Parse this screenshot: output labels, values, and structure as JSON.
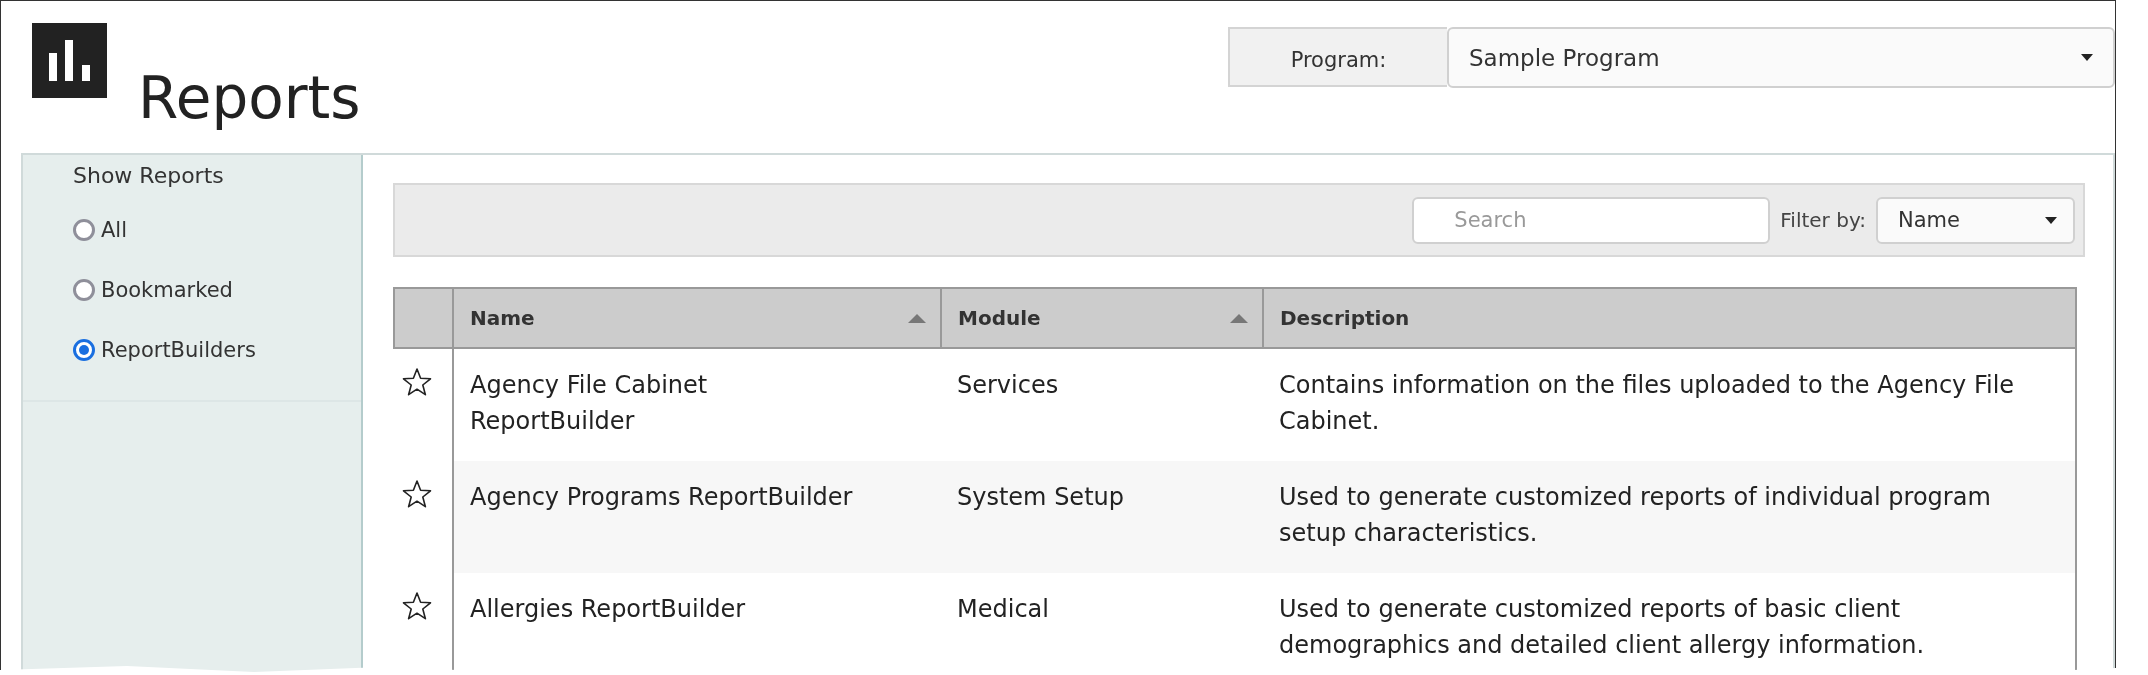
{
  "header": {
    "title": "Reports",
    "program_label": "Program:",
    "program_value": "Sample Program"
  },
  "sidebar": {
    "title": "Show Reports",
    "options": [
      {
        "label": "All",
        "selected": false
      },
      {
        "label": "Bookmarked",
        "selected": false
      },
      {
        "label": "ReportBuilders",
        "selected": true
      }
    ]
  },
  "toolbar": {
    "search": {
      "placeholder": "Search"
    },
    "filter_label": "Filter by:",
    "filter_value": "Name"
  },
  "table": {
    "columns": [
      {
        "label": "Name",
        "sorted": true
      },
      {
        "label": "Module",
        "sorted": true
      },
      {
        "label": "Description",
        "sorted": false
      }
    ],
    "rows": [
      {
        "bookmarked": false,
        "name": "Agency File Cabinet ReportBuilder",
        "module": "Services",
        "description": "Contains information on the files uploaded to the Agency File Cabinet."
      },
      {
        "bookmarked": false,
        "name": "Agency Programs ReportBuilder",
        "module": "System Setup",
        "description": "Used to generate customized reports of individual program setup characteristics."
      },
      {
        "bookmarked": false,
        "name": "Allergies ReportBuilder",
        "module": "Medical",
        "description": "Used to generate customized reports of basic client demographics and detailed client allergy information."
      }
    ]
  }
}
